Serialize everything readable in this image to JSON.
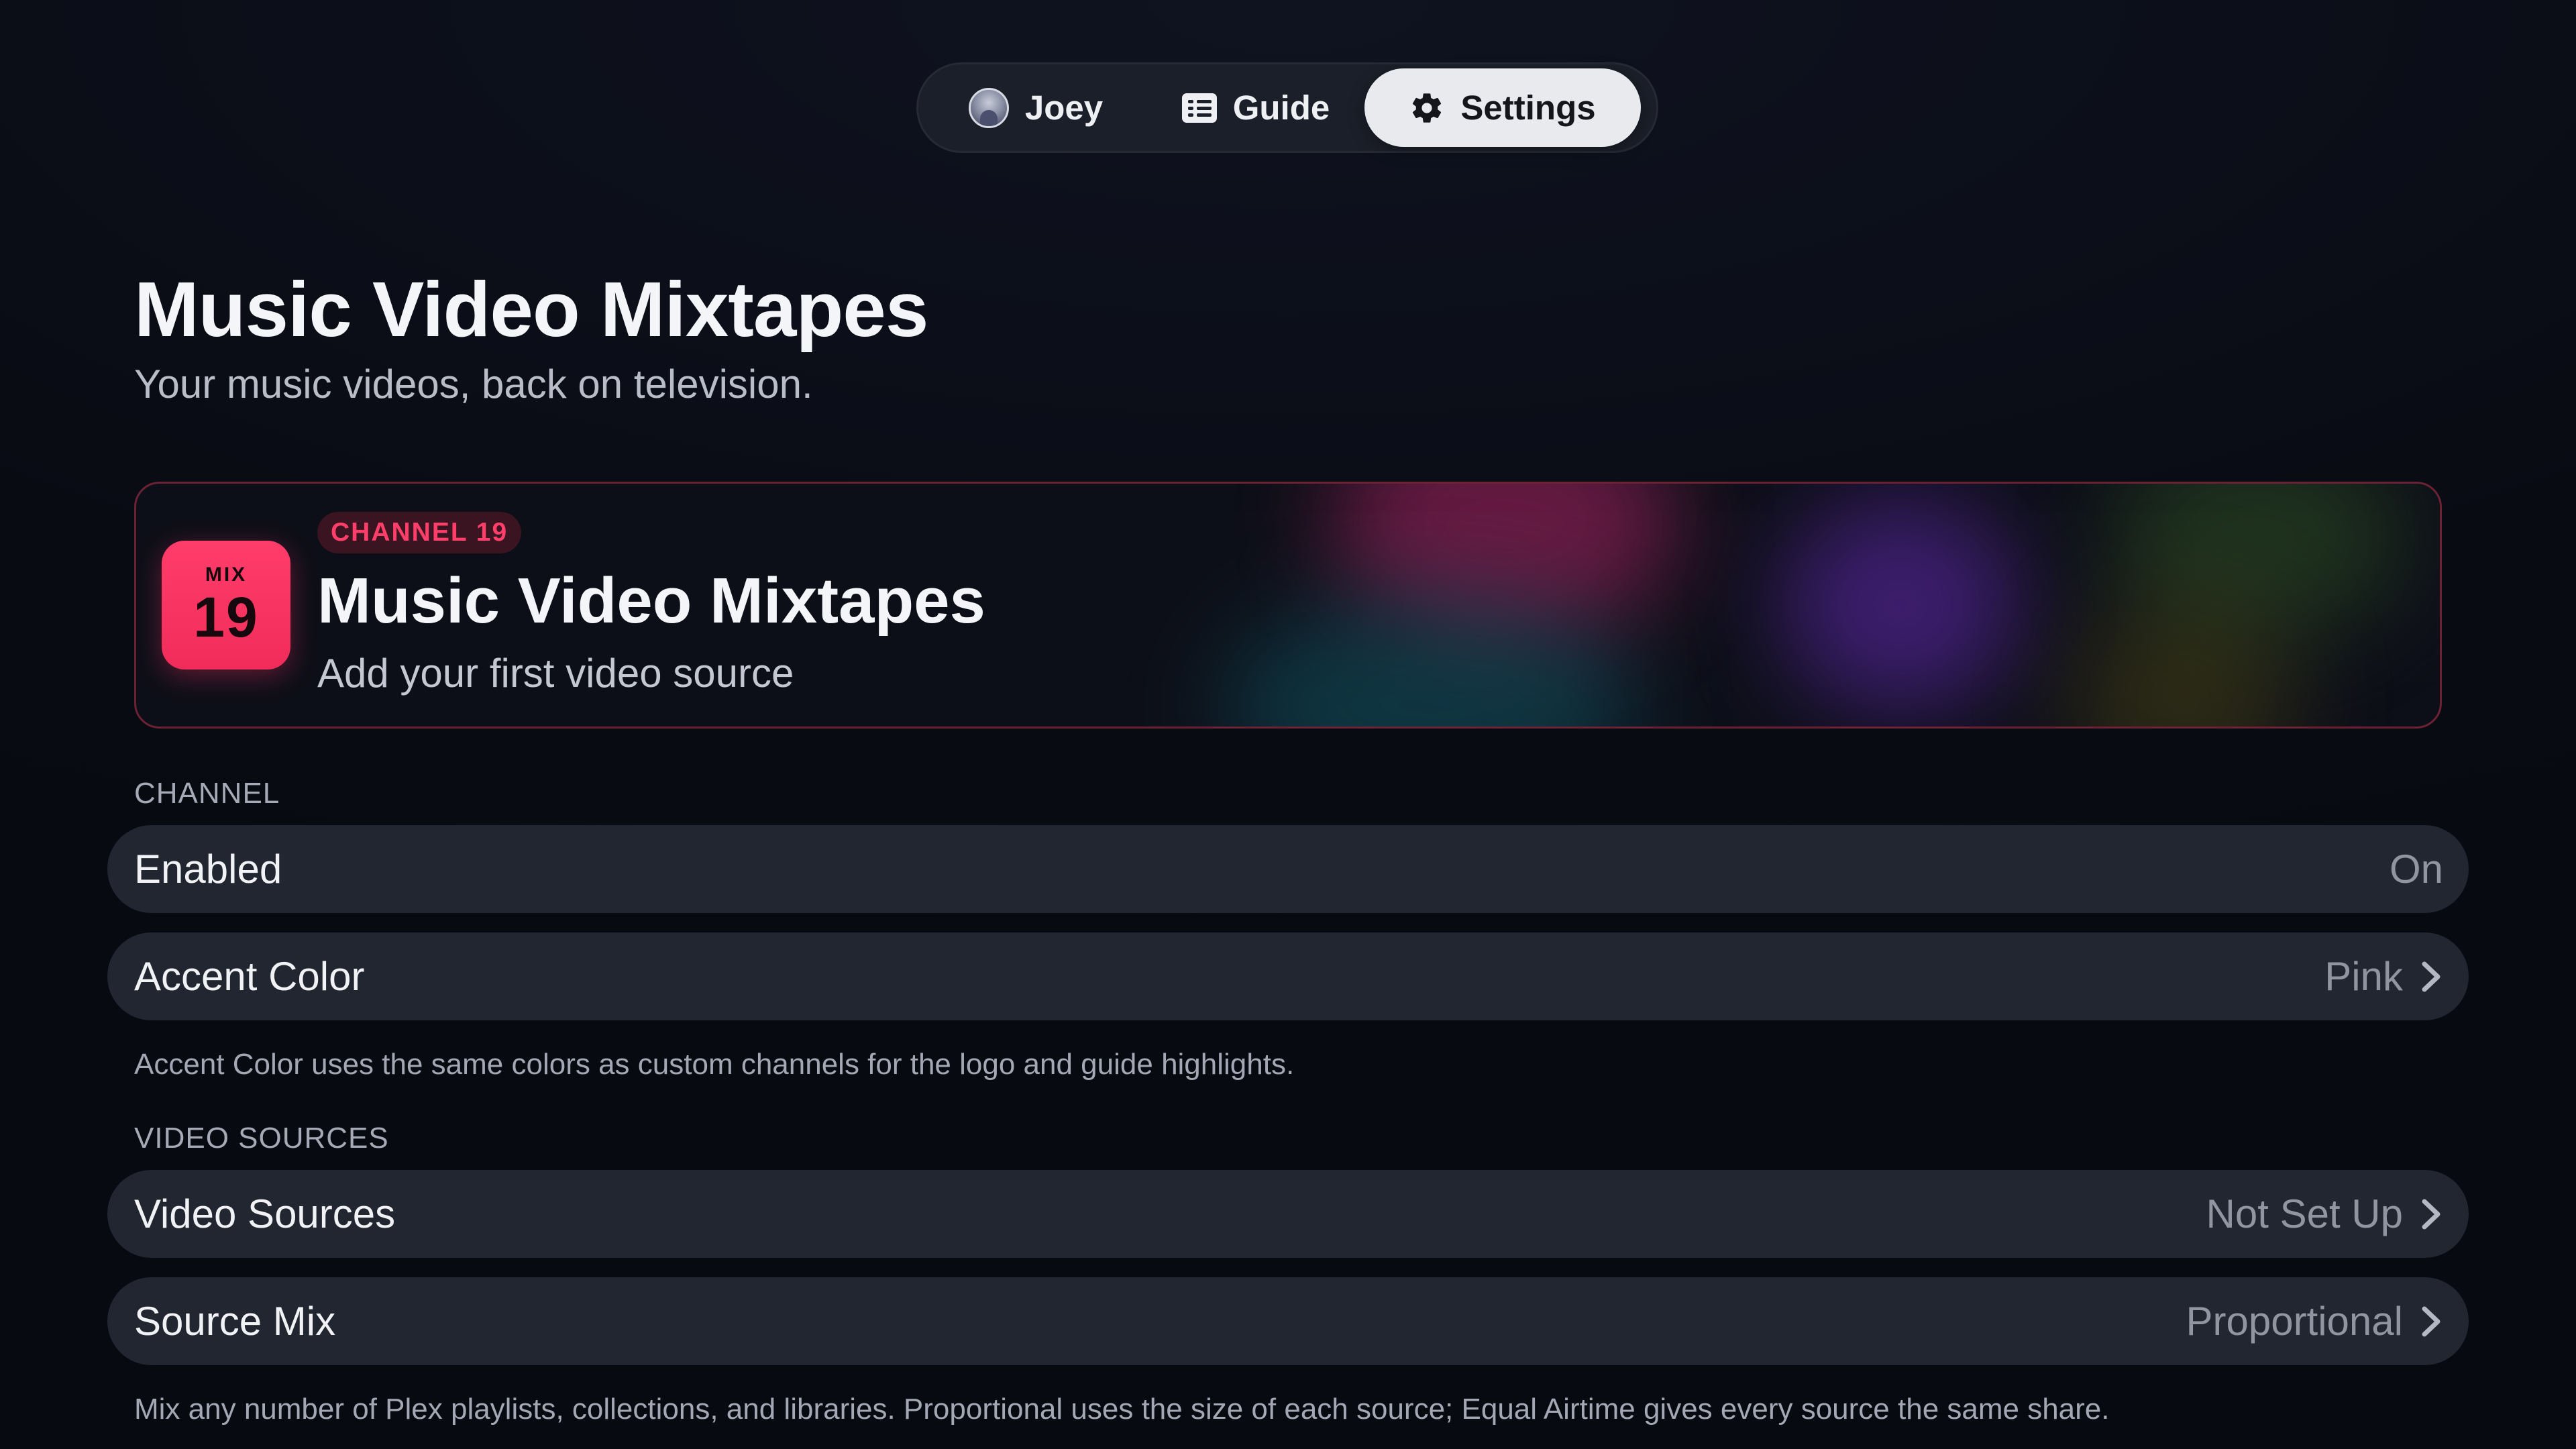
{
  "nav": {
    "tabs": [
      {
        "label": "Joey",
        "icon": "avatar"
      },
      {
        "label": "Guide",
        "icon": "guide-icon"
      },
      {
        "label": "Settings",
        "icon": "gear-icon",
        "selected": true
      }
    ]
  },
  "header": {
    "title": "Music Video Mixtapes",
    "subtitle": "Your music videos, back on television."
  },
  "hero": {
    "logo_top": "MIX",
    "logo_number": "19",
    "badge": "CHANNEL 19",
    "title": "Music Video Mixtapes",
    "subtitle": "Add your first video source",
    "accent_color": "#ff3d6a"
  },
  "sections": {
    "channel": {
      "label": "CHANNEL",
      "rows": [
        {
          "label": "Enabled",
          "value": "On"
        },
        {
          "label": "Accent Color",
          "value": "Pink"
        }
      ],
      "footnote": "Accent Color uses the same colors as custom channels for the logo and guide highlights."
    },
    "video_sources": {
      "label": "VIDEO SOURCES",
      "rows": [
        {
          "label": "Video Sources",
          "value": "Not Set Up"
        },
        {
          "label": "Source Mix",
          "value": "Proportional"
        }
      ],
      "footnote": "Mix any number of Plex playlists, collections, and libraries. Proportional uses the size of each source; Equal Airtime gives every source the same share."
    }
  }
}
